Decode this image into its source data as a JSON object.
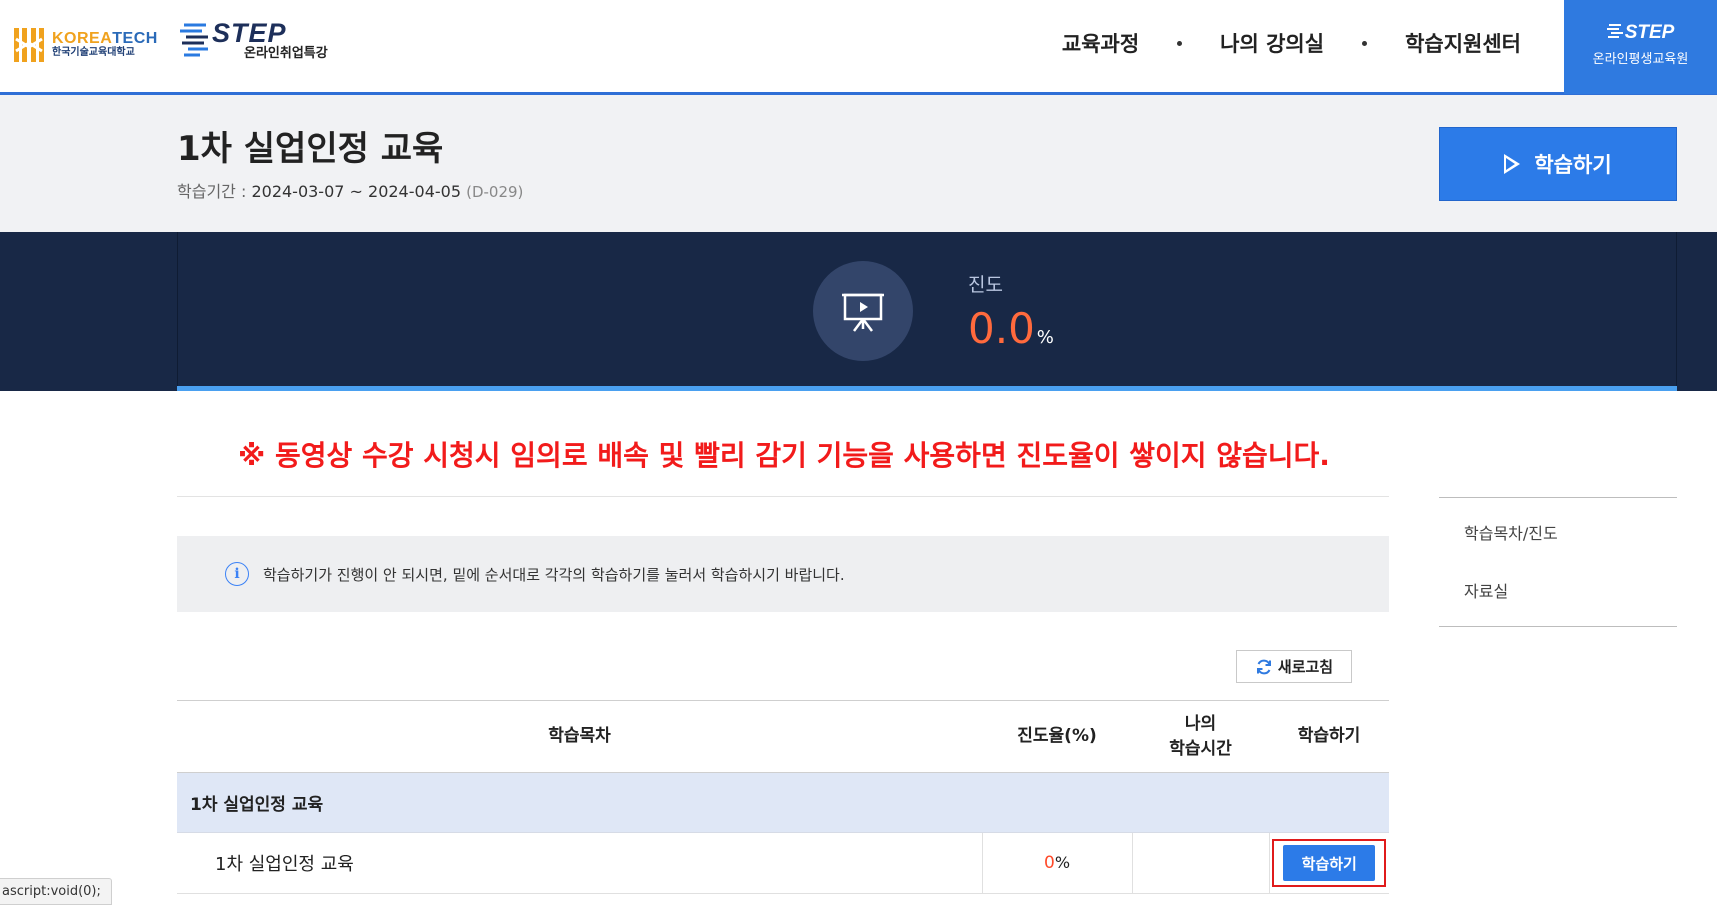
{
  "header": {
    "koreatech_logo": {
      "en_prefix": "KOREA",
      "en_suffix": "TECH",
      "ko": "한국기술교육대학교"
    },
    "step_logo": {
      "en": "STEP",
      "ko": "온라인취업특강"
    },
    "gnb": [
      "교육과정",
      "나의 강의실",
      "학습지원센터"
    ],
    "step_box": {
      "en": "STEP",
      "ko": "온라인평생교육원"
    }
  },
  "course": {
    "title": "1차 실업인정 교육",
    "period_label": "학습기간 : ",
    "period_value": "2024-03-07 ~ 2024-04-05",
    "dday": "(D-029)",
    "learn_button": "학습하기"
  },
  "progress": {
    "label": "진도",
    "value": "0.0",
    "unit": "%",
    "fraction": 0.0
  },
  "warning": "※ 동영상 수강 시청시 임의로 배속 및 빨리 감기 기능을 사용하면 진도율이 쌓이지 않습니다.",
  "info": {
    "icon": "i",
    "text": "학습하기가 진행이 안 되시면, 밑에 순서대로 각각의 학습하기를 눌러서 학습하시기 바랍니다."
  },
  "refresh_button": "새로고침",
  "table": {
    "headers": {
      "toc": "학습목차",
      "rate": "진도율(%)",
      "time_line1": "나의",
      "time_line2": "학습시간",
      "action": "학습하기"
    },
    "group": "1차 실업인정 교육",
    "rows": [
      {
        "name": "1차 실업인정 교육",
        "rate": "0",
        "rate_unit": "%",
        "time": "",
        "action": "학습하기"
      }
    ]
  },
  "side_nav": [
    "학습목차/진도",
    "자료실"
  ],
  "status_bar": "ascript:void(0);",
  "colors": {
    "accent_blue": "#2c7be8",
    "navy_band": "#182846",
    "progress_orange": "#ff6a3d",
    "warning_red": "#f21b1b",
    "group_row_bg": "#dfe7f6"
  }
}
